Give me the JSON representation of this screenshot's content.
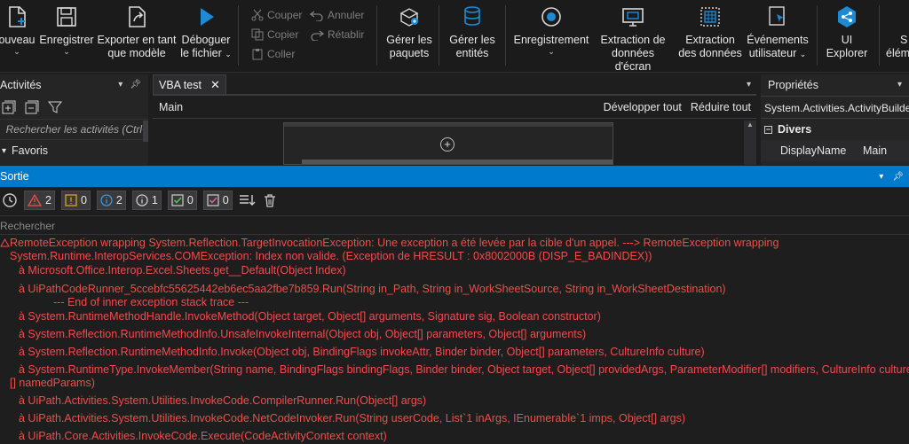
{
  "ribbon": {
    "nouveau": "ouveau",
    "enregistrer": "Enregistrer",
    "exporter_l1": "Exporter en tant",
    "exporter_l2": "que modèle",
    "deboguer_l1": "Déboguer",
    "deboguer_l2": "le fichier",
    "couper": "Couper",
    "copier": "Copier",
    "coller": "Coller",
    "annuler": "Annuler",
    "retablir": "Rétablir",
    "gerer_paquets_l1": "Gérer les",
    "gerer_paquets_l2": "paquets",
    "gerer_entites_l1": "Gérer les",
    "gerer_entites_l2": "entités",
    "enregistrement": "Enregistrement",
    "extraction_ecran_l1": "Extraction de",
    "extraction_ecran_l2": "données d'écran",
    "extraction_donnees_l1": "Extraction",
    "extraction_donnees_l2": "des données",
    "evenements_l1": "Événements",
    "evenements_l2": "utilisateur",
    "ui_explorer_l1": "UI",
    "ui_explorer_l2": "Explorer",
    "selection_l1": "S",
    "selection_l2": "élém"
  },
  "activities": {
    "title": "Activités",
    "search_placeholder": "Rechercher les activités (Ctrl+",
    "favoris": "Favoris"
  },
  "designer": {
    "tab_label": "VBA test",
    "breadcrumb": "Main",
    "expand_all": "Développer tout",
    "collapse_all": "Réduire tout"
  },
  "properties": {
    "title": "Propriétés",
    "type": "System.Activities.ActivityBuilder",
    "category": "Divers",
    "prop_name": "DisplayName",
    "prop_value": "Main"
  },
  "output": {
    "title": "Sortie",
    "filters": [
      {
        "name": "error",
        "count": "2"
      },
      {
        "name": "warning",
        "count": "0"
      },
      {
        "name": "info",
        "count": "2"
      },
      {
        "name": "trace",
        "count": "1"
      },
      {
        "name": "verbose",
        "count": "0"
      },
      {
        "name": "success",
        "count": "0"
      }
    ],
    "search_placeholder": "Rechercher",
    "log_lines": [
      "RemoteException wrapping System.Reflection.TargetInvocationException: Une exception a été levée par la cible d'un appel.  ---> RemoteException wrapping",
      "System.Runtime.InteropServices.COMException: Index non valide. (Exception de HRESULT : 0x8002000B (DISP_E_BADINDEX))",
      "à Microsoft.Office.Interop.Excel.Sheets.get__Default(Object Index)",
      "à UiPathCodeRunner_5ccebfc55625442eb6ec5aa2fbe7b859.Run(String in_Path, String in_WorkSheetSource, String in_WorkSheetDestination)",
      "--- End of inner exception stack trace ---",
      "à System.RuntimeMethodHandle.InvokeMethod(Object target, Object[] arguments, Signature sig, Boolean constructor)",
      "à System.Reflection.RuntimeMethodInfo.UnsafeInvokeInternal(Object obj, Object[] parameters, Object[] arguments)",
      "à System.Reflection.RuntimeMethodInfo.Invoke(Object obj, BindingFlags invokeAttr, Binder binder, Object[] parameters, CultureInfo culture)",
      "à System.RuntimeType.InvokeMember(String name, BindingFlags bindingFlags, Binder binder, Object target, Object[] providedArgs, ParameterModifier[] modifiers, CultureInfo culture, String",
      "[] namedParams)",
      "à UiPath.Activities.System.Utilities.InvokeCode.CompilerRunner.Run(Object[] args)",
      "à UiPath.Activities.System.Utilities.InvokeCode.NetCodeInvoker.Run(String userCode, List`1 inArgs, IEnumerable`1 imps, Object[] args)",
      "à UiPath.Core.Activities.InvokeCode.Execute(CodeActivityContext context)"
    ]
  },
  "colors": {
    "accent": "#007acc",
    "error_text": "#f14c4c",
    "icon_blue": "#1e8ad6"
  }
}
